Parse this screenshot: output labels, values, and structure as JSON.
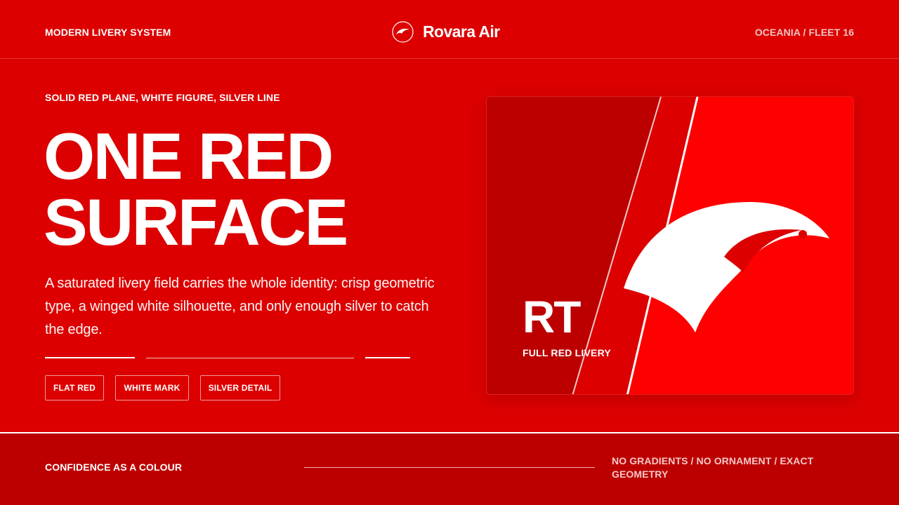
{
  "header": {
    "left_label": "MODERN LIVERY SYSTEM",
    "brand_name": "Rovara Air",
    "brand_icon": "winged-mark-icon",
    "right_label": "OCEANIA / FLEET 16"
  },
  "hero": {
    "eyebrow": "SOLID RED PLANE, WHITE FIGURE, SILVER LINE",
    "headline_line1": "ONE RED",
    "headline_line2": "SURFACE",
    "body": "A saturated livery field carries the whole identity: crisp geometric type, a winged white silhouette, and only enough silver to catch the edge."
  },
  "chips": [
    "FLAT RED",
    "WHITE MARK",
    "SILVER DETAIL"
  ],
  "card": {
    "code": "RT",
    "caption": "FULL RED LIVERY",
    "figure_icon": "winged-figure-icon"
  },
  "footer": {
    "left_label": "CONFIDENCE AS A COLOUR",
    "right_label": "NO GRADIENTS / NO ORNAMENT / EXACT GEOMETRY"
  },
  "colors": {
    "field_red": "#dc0000",
    "deep_red": "#bc0000",
    "bright_red": "#ff0000",
    "white": "#ffffff",
    "silver": "#f2c4c4"
  }
}
